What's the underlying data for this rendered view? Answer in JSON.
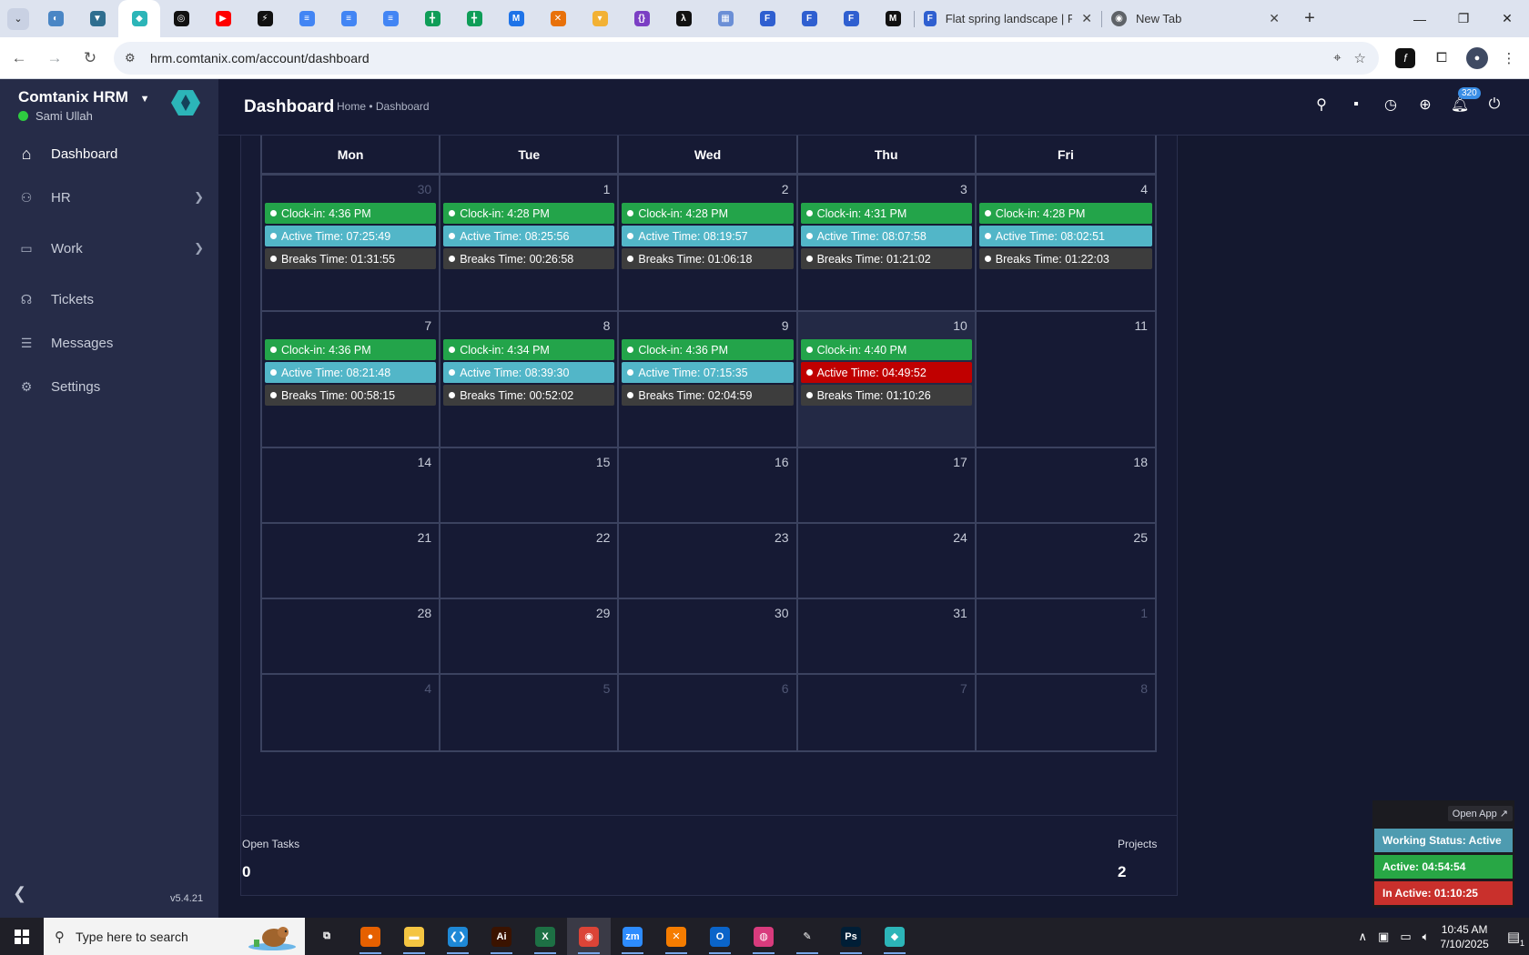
{
  "browser": {
    "pinned_tabs": [
      {
        "name": "favicon-1",
        "color": "#4a86c5",
        "glyph": "◐"
      },
      {
        "name": "favicon-2",
        "color": "#2f6e8f",
        "glyph": "▼"
      },
      {
        "name": "favicon-hrm",
        "color": "#2cb5b8",
        "glyph": "◆"
      },
      {
        "name": "favicon-4",
        "color": "#111111",
        "glyph": "◎"
      },
      {
        "name": "youtube",
        "color": "#ff0000",
        "glyph": "▶"
      },
      {
        "name": "favicon-6",
        "color": "#111111",
        "glyph": "⚡"
      },
      {
        "name": "docs-1",
        "color": "#4285f4",
        "glyph": "≡"
      },
      {
        "name": "docs-2",
        "color": "#4285f4",
        "glyph": "≡"
      },
      {
        "name": "docs-3",
        "color": "#4285f4",
        "glyph": "≡"
      },
      {
        "name": "sheets-1",
        "color": "#0f9d58",
        "glyph": "╋"
      },
      {
        "name": "sheets-2",
        "color": "#0f9d58",
        "glyph": "╋"
      },
      {
        "name": "favicon-12",
        "color": "#1e73e8",
        "glyph": "M"
      },
      {
        "name": "favicon-13",
        "color": "#e8710a",
        "glyph": "✕"
      },
      {
        "name": "favicon-14",
        "color": "#f2b134",
        "glyph": "▾"
      },
      {
        "name": "favicon-15",
        "color": "#7b3fc4",
        "glyph": "{}"
      },
      {
        "name": "favicon-16",
        "color": "#111111",
        "glyph": "λ"
      },
      {
        "name": "favicon-17",
        "color": "#6b8fd6",
        "glyph": "▦"
      },
      {
        "name": "forms-1",
        "color": "#2f5fd0",
        "glyph": "F"
      },
      {
        "name": "forms-2",
        "color": "#2f5fd0",
        "glyph": "F"
      },
      {
        "name": "forms-3",
        "color": "#2f5fd0",
        "glyph": "F"
      },
      {
        "name": "favicon-21",
        "color": "#111111",
        "glyph": "M"
      }
    ],
    "tabs": [
      {
        "title": "Flat spring landscape | Free V",
        "close": "✕"
      },
      {
        "title": "New Tab",
        "close": "✕"
      }
    ],
    "url": "hrm.comtanix.com/account/dashboard"
  },
  "sidebar": {
    "brand": "Comtanix HRM",
    "user": "Sami Ullah",
    "items": [
      {
        "label": "Dashboard",
        "icon": "home-icon",
        "glyph": "⌂"
      },
      {
        "label": "HR",
        "icon": "users-icon",
        "glyph": "⚇"
      },
      {
        "label": "Work",
        "icon": "briefcase-icon",
        "glyph": "▭"
      },
      {
        "label": "Tickets",
        "icon": "headset-icon",
        "glyph": "☊"
      },
      {
        "label": "Messages",
        "icon": "chat-icon",
        "glyph": "☰"
      },
      {
        "label": "Settings",
        "icon": "gear-icon",
        "glyph": "⚙"
      }
    ],
    "version": "v5.4.21"
  },
  "header": {
    "title": "Dashboard",
    "breadcrumb": "Home • Dashboard",
    "notification_count": "320"
  },
  "calendar": {
    "weekdays": [
      "Mon",
      "Tue",
      "Wed",
      "Thu",
      "Fri"
    ],
    "weeks": [
      [
        {
          "day": "30",
          "muted": true,
          "events": [
            {
              "type": "clockin",
              "text": "Clock-in: 4:36 PM"
            },
            {
              "type": "active",
              "text": "Active Time: 07:25:49"
            },
            {
              "type": "breaks",
              "text": "Breaks Time: 01:31:55"
            }
          ]
        },
        {
          "day": "1",
          "events": [
            {
              "type": "clockin",
              "text": "Clock-in: 4:28 PM"
            },
            {
              "type": "active",
              "text": "Active Time: 08:25:56"
            },
            {
              "type": "breaks",
              "text": "Breaks Time: 00:26:58"
            }
          ]
        },
        {
          "day": "2",
          "events": [
            {
              "type": "clockin",
              "text": "Clock-in: 4:28 PM"
            },
            {
              "type": "active",
              "text": "Active Time: 08:19:57"
            },
            {
              "type": "breaks",
              "text": "Breaks Time: 01:06:18"
            }
          ]
        },
        {
          "day": "3",
          "events": [
            {
              "type": "clockin",
              "text": "Clock-in: 4:31 PM"
            },
            {
              "type": "active",
              "text": "Active Time: 08:07:58"
            },
            {
              "type": "breaks",
              "text": "Breaks Time: 01:21:02"
            }
          ]
        },
        {
          "day": "4",
          "events": [
            {
              "type": "clockin",
              "text": "Clock-in: 4:28 PM"
            },
            {
              "type": "active",
              "text": "Active Time: 08:02:51"
            },
            {
              "type": "breaks",
              "text": "Breaks Time: 01:22:03"
            }
          ]
        }
      ],
      [
        {
          "day": "7",
          "events": [
            {
              "type": "clockin",
              "text": "Clock-in: 4:36 PM"
            },
            {
              "type": "active",
              "text": "Active Time: 08:21:48"
            },
            {
              "type": "breaks",
              "text": "Breaks Time: 00:58:15"
            }
          ]
        },
        {
          "day": "8",
          "events": [
            {
              "type": "clockin",
              "text": "Clock-in: 4:34 PM"
            },
            {
              "type": "active",
              "text": "Active Time: 08:39:30"
            },
            {
              "type": "breaks",
              "text": "Breaks Time: 00:52:02"
            }
          ]
        },
        {
          "day": "9",
          "events": [
            {
              "type": "clockin",
              "text": "Clock-in: 4:36 PM"
            },
            {
              "type": "active",
              "text": "Active Time: 07:15:35"
            },
            {
              "type": "breaks",
              "text": "Breaks Time: 02:04:59"
            }
          ]
        },
        {
          "day": "10",
          "today": true,
          "events": [
            {
              "type": "clockin",
              "text": "Clock-in: 4:40 PM"
            },
            {
              "type": "inactive",
              "text": "Active Time: 04:49:52"
            },
            {
              "type": "breaks",
              "text": "Breaks Time: 01:10:26"
            }
          ]
        },
        {
          "day": "11",
          "events": []
        }
      ],
      [
        {
          "day": "14",
          "events": []
        },
        {
          "day": "15",
          "events": []
        },
        {
          "day": "16",
          "events": []
        },
        {
          "day": "17",
          "events": []
        },
        {
          "day": "18",
          "events": []
        }
      ],
      [
        {
          "day": "21",
          "events": []
        },
        {
          "day": "22",
          "events": []
        },
        {
          "day": "23",
          "events": []
        },
        {
          "day": "24",
          "events": []
        },
        {
          "day": "25",
          "events": []
        }
      ],
      [
        {
          "day": "28",
          "events": []
        },
        {
          "day": "29",
          "events": []
        },
        {
          "day": "30",
          "events": []
        },
        {
          "day": "31",
          "events": []
        },
        {
          "day": "1",
          "muted": true,
          "events": []
        }
      ],
      [
        {
          "day": "4",
          "muted": true,
          "events": []
        },
        {
          "day": "5",
          "muted": true,
          "events": []
        },
        {
          "day": "6",
          "muted": true,
          "events": []
        },
        {
          "day": "7",
          "muted": true,
          "events": []
        },
        {
          "day": "8",
          "muted": true,
          "events": []
        }
      ]
    ]
  },
  "stats": {
    "open_tasks_label": "Open Tasks",
    "open_tasks_value": "0",
    "projects_label": "Projects",
    "projects_value": "2"
  },
  "widget": {
    "open_app": "Open App ↗",
    "working_status": "Working Status: Active",
    "active": "Active: 04:54:54",
    "inactive": "In Active: 01:10:25"
  },
  "taskbar": {
    "search_placeholder": "Type here to search",
    "apps": [
      {
        "name": "task-view",
        "color": "transparent",
        "glyph": "⧉",
        "running": false
      },
      {
        "name": "firefox",
        "color": "#e66000",
        "glyph": "●",
        "running": true
      },
      {
        "name": "file-explorer",
        "color": "#f4c542",
        "glyph": "▬",
        "running": true
      },
      {
        "name": "vscode",
        "color": "#1e88d6",
        "glyph": "❮❯",
        "running": true
      },
      {
        "name": "illustrator",
        "color": "#3a1300",
        "glyph": "Ai",
        "running": true
      },
      {
        "name": "excel",
        "color": "#1d7044",
        "glyph": "X",
        "running": true
      },
      {
        "name": "chrome",
        "color": "#db4437",
        "glyph": "◉",
        "running": true,
        "active": true
      },
      {
        "name": "zoom",
        "color": "#2d8cff",
        "glyph": "zm",
        "running": true
      },
      {
        "name": "xampp",
        "color": "#f57c00",
        "glyph": "✕",
        "running": true
      },
      {
        "name": "outlook",
        "color": "#0a64c9",
        "glyph": "O",
        "running": true
      },
      {
        "name": "creative-cloud",
        "color": "#d83b7d",
        "glyph": "◍",
        "running": true
      },
      {
        "name": "pen-tool",
        "color": "transparent",
        "glyph": "✎",
        "running": true
      },
      {
        "name": "photoshop",
        "color": "#001e36",
        "glyph": "Ps",
        "running": true
      },
      {
        "name": "hrm-app",
        "color": "#2cb5b8",
        "glyph": "◆",
        "running": true
      }
    ],
    "time": "10:45 AM",
    "date": "7/10/2025",
    "notification_count": "1"
  }
}
